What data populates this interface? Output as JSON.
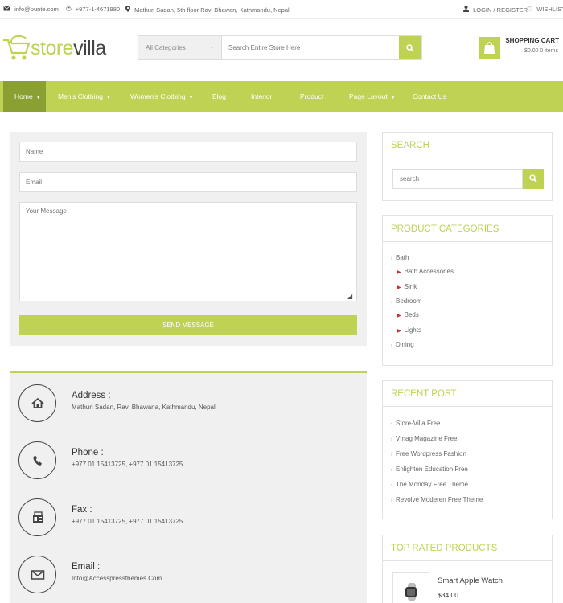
{
  "topbar": {
    "email": "info@punte.com",
    "phone": "+977-1-4671980",
    "address": "Mathuri Sadan, 5th floor Ravi Bhawan, Kathmandu, Nepal",
    "login": "LOGIN / REGISTER",
    "wishlist": "WISHLIST"
  },
  "logo": {
    "part1": "store",
    "part2": "villa"
  },
  "search": {
    "category": "All Categories",
    "placeholder": "Search Entire Store Here"
  },
  "cart": {
    "title": "SHOPPING CART",
    "amount": "$0.00 0 items"
  },
  "nav": {
    "items": [
      {
        "label": "Home"
      },
      {
        "label": "Men's Clothing"
      },
      {
        "label": "Women's Clothing"
      },
      {
        "label": "Blog"
      },
      {
        "label": "Interior"
      },
      {
        "label": "Product"
      },
      {
        "label": "Page Layout"
      },
      {
        "label": "Contact Us"
      }
    ]
  },
  "form": {
    "name_placeholder": "Name",
    "email_placeholder": "Email",
    "message_placeholder": "Your Message",
    "submit_label": "SEND MESSAGE"
  },
  "contact": {
    "address_title": "Address :",
    "address_text": "Mathuri Sadan, Ravi Bhawana, Kathmandu, Nepal",
    "phone_title": "Phone :",
    "phone_text": "+977 01 15413725, +977 01 15413725",
    "fax_title": "Fax :",
    "fax_text": "+977 01 15413725, +977 01 15413725",
    "email_title": "Email :",
    "email_text": "Info@Accesspressthemes.Com"
  },
  "sidebar": {
    "search_title": "SEARCH",
    "search_placeholder": "search",
    "categories_title": "PRODUCT CATEGORIES",
    "categories": [
      {
        "label": "Bath"
      },
      {
        "label": "Bath Accessories"
      },
      {
        "label": "Sink"
      },
      {
        "label": "Bedroom"
      },
      {
        "label": "Beds"
      },
      {
        "label": "Lights"
      },
      {
        "label": "Dining"
      }
    ],
    "recent_title": "RECENT POST",
    "recent": [
      {
        "label": "Store-Villa Free"
      },
      {
        "label": "Vmag Magazine Free"
      },
      {
        "label": "Free Wordpress Fashion"
      },
      {
        "label": "Enlighten Education Free"
      },
      {
        "label": "The Monday Free Theme"
      },
      {
        "label": "Revolve Moderen Free Theme"
      }
    ],
    "top_rated_title": "TOP RATED PRODUCTS",
    "product_name": "Smart Apple Watch",
    "product_price": "$34.00"
  },
  "colors": {
    "accent": "#bfd253",
    "accent_dark": "#8aa033",
    "panel": "#f0f0f0"
  },
  "icons": [
    "envelope-icon",
    "phone-icon",
    "map-marker-icon",
    "user-icon",
    "heart-icon",
    "search-icon",
    "shopping-bag-icon",
    "home-icon",
    "fax-icon"
  ]
}
